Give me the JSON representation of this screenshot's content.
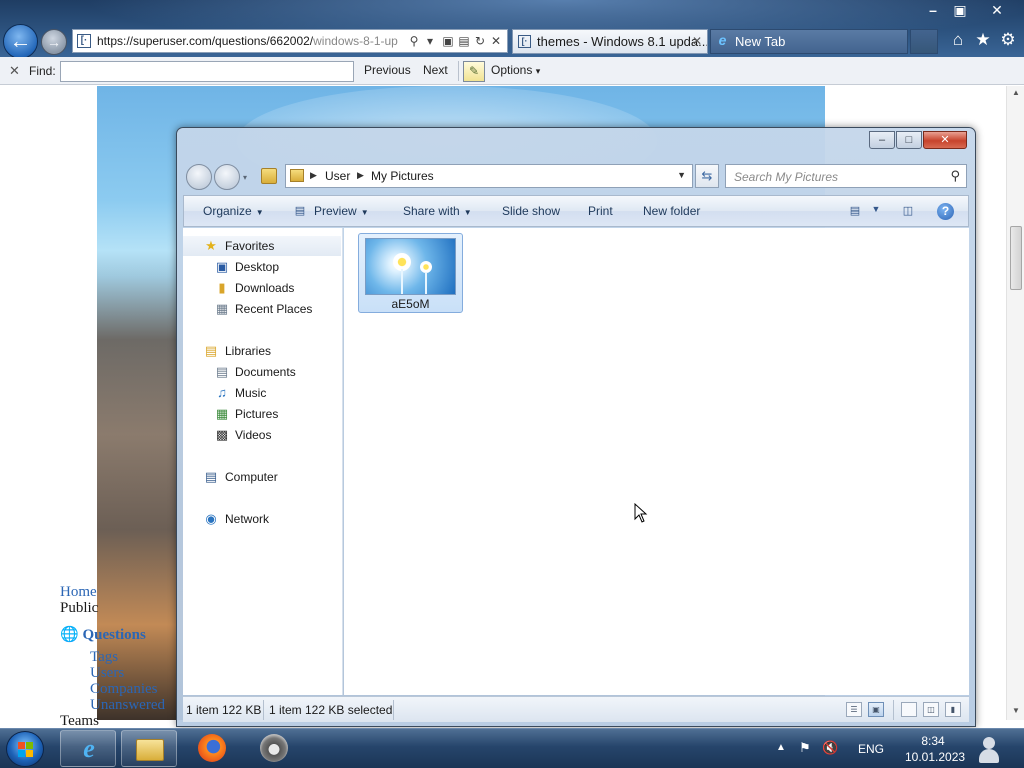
{
  "browser": {
    "url_main": "https://superuser.com/questions/662002/",
    "url_dim": "windows-8-1-up",
    "favicon_glyph": "[·",
    "tabs": [
      {
        "title": "themes - Windows 8.1 upda...",
        "close": "✕"
      },
      {
        "title": "New Tab"
      }
    ],
    "window_controls": [
      "–",
      "▣",
      "✕"
    ],
    "icons": [
      "home-icon",
      "star-icon",
      "gear-icon"
    ]
  },
  "find_bar": {
    "close": "✕",
    "label": "Find:",
    "query": "",
    "previous": "Previous",
    "next": "Next",
    "options": "Options"
  },
  "page": {
    "home": "Home",
    "public": "Public",
    "questions": "Questions",
    "tags": "Tags",
    "users": "Users",
    "companies": "Companies",
    "unanswered": "Unanswered",
    "teams": "Teams"
  },
  "explorer": {
    "breadcrumb": [
      "User",
      "My Pictures"
    ],
    "search_placeholder": "Search My Pictures",
    "toolbar": {
      "organize": "Organize",
      "preview": "Preview",
      "share_with": "Share with",
      "slide_show": "Slide show",
      "print": "Print",
      "new_folder": "New folder"
    },
    "nav": {
      "favorites": "Favorites",
      "desktop": "Desktop",
      "downloads": "Downloads",
      "recent_places": "Recent Places",
      "libraries": "Libraries",
      "documents": "Documents",
      "music": "Music",
      "pictures": "Pictures",
      "videos": "Videos",
      "computer": "Computer",
      "network": "Network"
    },
    "file": {
      "name": "aE5oM"
    },
    "status": {
      "items": "1 item 122 KB",
      "selected": "1 item 122 KB selected"
    }
  },
  "taskbar": {
    "language": "ENG",
    "time": "8:34",
    "date": "10.01.2023"
  },
  "colors": {
    "accent": "#2b66b5",
    "taskbar": "#26456b",
    "selection": "#c9e0f8"
  }
}
